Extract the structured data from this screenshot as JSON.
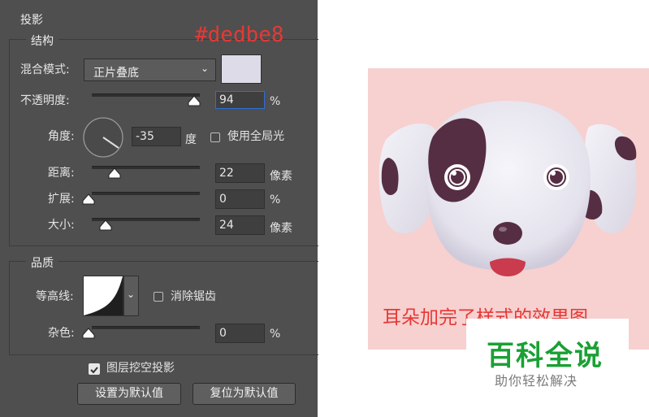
{
  "panel": {
    "title": "投影",
    "structure": {
      "heading": "结构",
      "blend_label": "混合模式:",
      "blend_value": "正片叠底",
      "color_swatch": "#dedbe8",
      "opacity_label": "不透明度:",
      "opacity_value": "94",
      "opacity_unit": "%",
      "angle_label": "角度:",
      "angle_value": "-35",
      "angle_unit": "度",
      "global_light_label": "使用全局光",
      "global_light_checked": false,
      "distance_label": "距离:",
      "distance_value": "22",
      "distance_unit": "像素",
      "spread_label": "扩展:",
      "spread_value": "0",
      "spread_unit": "%",
      "size_label": "大小:",
      "size_value": "24",
      "size_unit": "像素"
    },
    "quality": {
      "heading": "品质",
      "contour_label": "等高线:",
      "antialias_label": "消除锯齿",
      "antialias_checked": false,
      "noise_label": "杂色:",
      "noise_value": "0",
      "noise_unit": "%"
    },
    "knockout_label": "图层挖空投影",
    "knockout_checked": true,
    "set_default_label": "设置为默认值",
    "reset_default_label": "复位为默认值"
  },
  "annotation": {
    "color_hex_note": "#dedbe8",
    "color": "#e53935"
  },
  "illustration": {
    "caption": "耳朵加完了样式的效果图",
    "caption_color": "#e53935",
    "background": "#f7d0d0"
  },
  "watermark": {
    "brand": "百科全说",
    "brand_color": "#1aa034",
    "slogan": "助你轻松解决"
  }
}
